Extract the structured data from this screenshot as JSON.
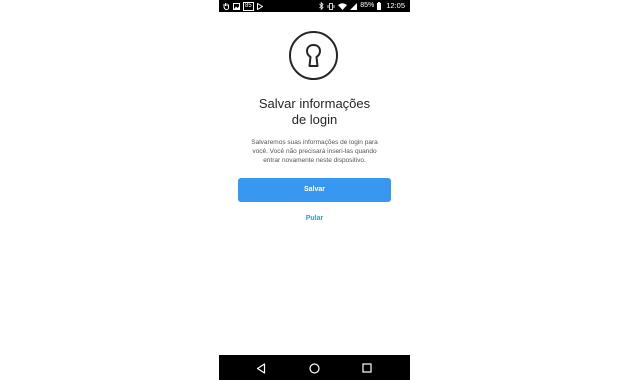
{
  "status_bar": {
    "left_icons": [
      "hand-icon",
      "image-icon",
      "app-badge-icon",
      "play-store-icon"
    ],
    "app_badge_text": "85",
    "right_icons": [
      "bluetooth-icon",
      "vibrate-icon",
      "wifi-icon",
      "signal-icon"
    ],
    "battery": "85%",
    "time": "12:05",
    "background": "#000000"
  },
  "login_save": {
    "icon": "keyhole-icon",
    "title_line1": "Salvar informações",
    "title_line2": "de login",
    "description_line1": "Salvaremos suas informações de login para",
    "description_line2": "você. Você não precisará inseri-las quando",
    "description_line3": "entrar novamente neste dispositivo.",
    "save_label": "Salvar",
    "skip_label": "Pular",
    "accent_color": "#3897f0"
  },
  "nav_bar": {
    "buttons": [
      "back-icon",
      "home-icon",
      "recents-icon"
    ]
  }
}
